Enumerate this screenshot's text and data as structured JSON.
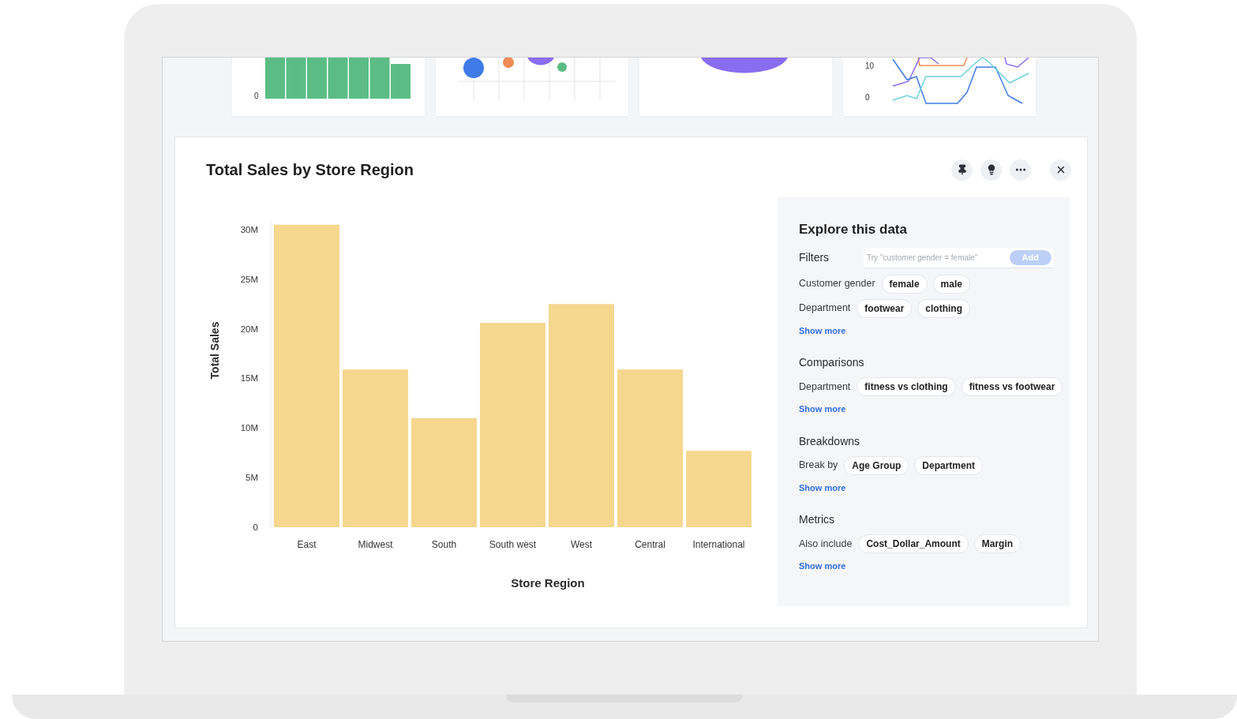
{
  "thumbnails": [
    {
      "kind": "bar",
      "ticks": [
        "0"
      ]
    },
    {
      "kind": "scatter"
    },
    {
      "kind": "pie"
    },
    {
      "kind": "line",
      "ticks": [
        "10",
        "0"
      ]
    }
  ],
  "card": {
    "title": "Total Sales by Store Region",
    "actions": [
      {
        "kind": "pin"
      },
      {
        "kind": "insight"
      },
      {
        "kind": "more"
      },
      {
        "kind": "close"
      }
    ],
    "chart_data": {
      "type": "bar",
      "xlabel": "Store Region",
      "ylabel": "Total Sales",
      "categories": [
        "East",
        "Midwest",
        "South",
        "South west",
        "West",
        "Central",
        "International"
      ],
      "series": [
        {
          "color": "#f5d78e",
          "values": [
            30500000,
            15900000,
            11000000,
            20600000,
            22500000,
            15900000,
            7700000
          ]
        }
      ],
      "ylim": [
        0,
        31000000
      ],
      "yticks": [
        {
          "value": 0,
          "label": "0"
        },
        {
          "value": 5000000,
          "label": "5M"
        },
        {
          "value": 10000000,
          "label": "10M"
        },
        {
          "value": 15000000,
          "label": "15M"
        },
        {
          "value": 20000000,
          "label": "20M"
        },
        {
          "value": 25000000,
          "label": "25M"
        },
        {
          "value": 30000000,
          "label": "30M"
        }
      ]
    },
    "explore": {
      "title": "Explore this data",
      "sections": [
        {
          "title": "Filters",
          "search": {
            "placeholder": "Try \"customer gender = female\"",
            "button": "Add"
          },
          "rows": [
            {
              "label": "Customer gender",
              "chips": [
                "female",
                "male"
              ]
            },
            {
              "label": "Department",
              "chips": [
                "footwear",
                "clothing"
              ]
            }
          ],
          "link": "Show more"
        },
        {
          "title": "Comparisons",
          "rows": [
            {
              "label": "Department",
              "chips": [
                "fitness vs clothing",
                "fitness vs footwear"
              ]
            }
          ],
          "link": "Show more"
        },
        {
          "title": "Breakdowns",
          "rows": [
            {
              "label": "Break by",
              "chips": [
                "Age Group",
                "Department"
              ]
            }
          ],
          "link": "Show more"
        },
        {
          "title": "Metrics",
          "rows": [
            {
              "label": "Also include",
              "chips": [
                "Cost_Dollar_Amount",
                "Margin"
              ]
            }
          ],
          "link": "Show more"
        }
      ]
    }
  }
}
